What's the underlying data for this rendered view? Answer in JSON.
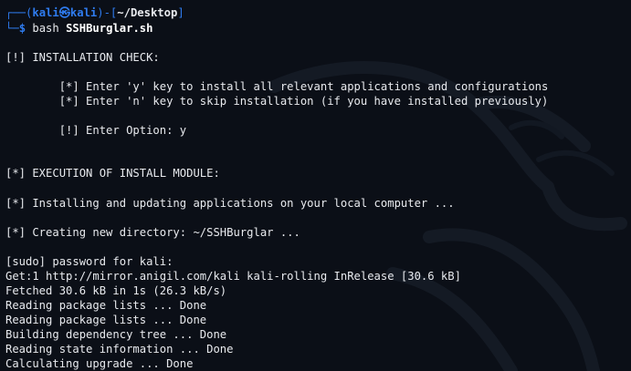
{
  "prompt": {
    "line1_open": "┌──(",
    "user": "kali㉿kali",
    "mid": ")-[",
    "path": "~/Desktop",
    "close": "]",
    "line2_prefix": "└─",
    "dollar": "$",
    "command": "bash",
    "argument": "SSHBurglar.sh"
  },
  "colors": {
    "background": "#0b0f17",
    "prompt_blue": "#2f7cf0",
    "text": "#e8eaee"
  },
  "icons": {
    "background": "kali-dragon-watermark"
  },
  "output_lines": [
    "[!] INSTALLATION CHECK:",
    "        [*] Enter 'y' key to install all relevant applications and configurations",
    "        [*] Enter 'n' key to skip installation (if you have installed previously)",
    "        [!] Enter Option: y",
    "[*] EXECUTION OF INSTALL MODULE:",
    "[*] Installing and updating applications on your local computer ...",
    "[*] Creating new directory: ~/SSHBurglar ...",
    "[sudo] password for kali:",
    "Get:1 http://mirror.anigil.com/kali kali-rolling InRelease [30.6 kB]",
    "Fetched 30.6 kB in 1s (26.3 kB/s)",
    "Reading package lists ... Done",
    "Reading package lists ... Done",
    "Building dependency tree ... Done",
    "Reading state information ... Done",
    "Calculating upgrade ... Done"
  ]
}
